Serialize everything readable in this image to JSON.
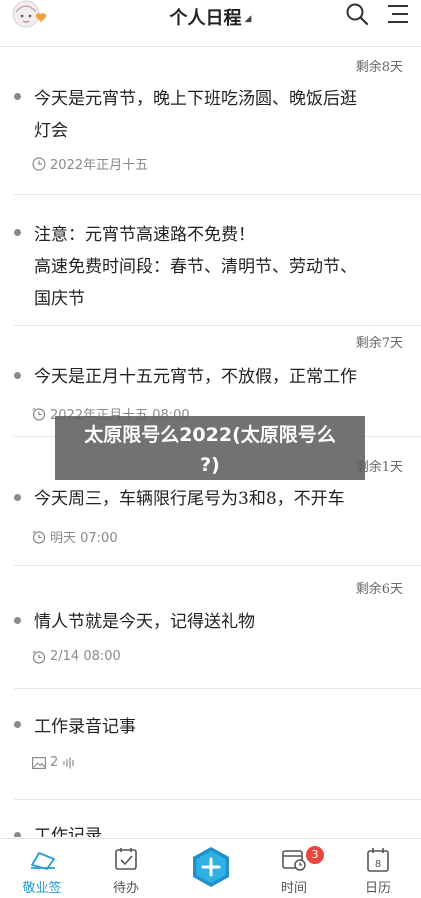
{
  "header": {
    "title": "个人日程",
    "title_caret": "◢"
  },
  "items": [
    {
      "remaining": "剩余8天",
      "text_lines": [
        "今天是元宵节，晚上下班吃汤圆、晚饭后逛",
        "灯会"
      ],
      "meta": "2022年正月十五",
      "meta_icon": "clock-icon"
    },
    {
      "remaining": "",
      "text_lines": [
        "注意：元宵节高速路不免费！",
        "高速免费时间段：春节、清明节、劳动节、",
        "国庆节"
      ],
      "meta": "",
      "meta_icon": ""
    },
    {
      "remaining": "剩余7天",
      "text_lines": [
        "今天是正月十五元宵节，不放假，正常工作"
      ],
      "meta": "2022年正月十五  08:00",
      "meta_icon": "alarm-repeat-icon"
    },
    {
      "remaining": "剩余1天",
      "text_lines": [
        "今天周三，车辆限行尾号为3和8，不开车"
      ],
      "meta": "明天  07:00",
      "meta_icon": "alarm-repeat-icon"
    },
    {
      "remaining": "剩余6天",
      "text_lines": [
        "情人节就是今天，记得送礼物"
      ],
      "meta": "2/14  08:00",
      "meta_icon": "alarm-repeat-icon"
    },
    {
      "remaining": "",
      "text_lines": [
        "工作录音记事"
      ],
      "meta": "2",
      "meta_icon": "image-icon"
    },
    {
      "remaining": "",
      "text_lines": [
        "工作记录"
      ],
      "meta": "",
      "meta_icon": ""
    }
  ],
  "watermark": {
    "line1": "太原限号么2022(太原限号么",
    "line2": "?)"
  },
  "tabbar": {
    "tabs": [
      {
        "label": "敬业签",
        "icon": "note-hand-icon",
        "active": true
      },
      {
        "label": "待办",
        "icon": "todo-check-icon",
        "active": false
      },
      {
        "label": "",
        "icon": "add-icon",
        "active": false
      },
      {
        "label": "时间",
        "icon": "calendar-clock-icon",
        "active": false,
        "badge": "3"
      },
      {
        "label": "日历",
        "icon": "calendar-icon",
        "active": false
      }
    ]
  },
  "colors": {
    "accent": "#2a9bd6",
    "badge": "#e8453c",
    "fab_outer": "#1f93c9",
    "fab_inner": "#2fb1e6",
    "avatar_heart": "#f2a341"
  }
}
